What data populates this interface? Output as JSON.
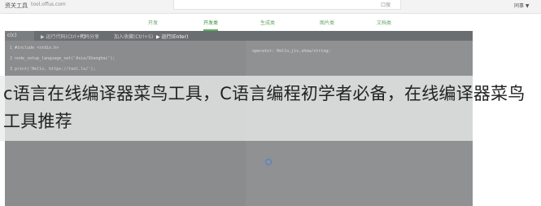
{
  "header": {
    "brand": "资关工具",
    "site": "tool.offus.com",
    "search_label": "口搜",
    "user": "同事 ▼"
  },
  "tabs": [
    {
      "label": "开发"
    },
    {
      "label": "开发类"
    },
    {
      "label": "生成类"
    },
    {
      "label": "图片类"
    },
    {
      "label": "文档类"
    }
  ],
  "toolbar": {
    "language": "c(c)",
    "items": [
      "▶ 运行代码(Ctrl+R)",
      "代码分享",
      "加入收藏(Ctrl+S)",
      "▶ 运行(Enter)"
    ]
  },
  "editor": {
    "lines": [
      "1  #include <stdio.h>",
      "2  node_setup_language_set('Asia/Shanghai');",
      "3  print('Hello, https://tool.lu/');"
    ],
    "output": "operator: Hello,jis.show/string;"
  },
  "caption": {
    "text": "c语言在线编译器菜鸟工具，C语言编程初学者必备，在线编译器菜鸟工具推荐"
  },
  "colors": {
    "editor_bg": "#8d8f91",
    "accent": "#5fae5f",
    "spinner": "#4f7fd8"
  }
}
